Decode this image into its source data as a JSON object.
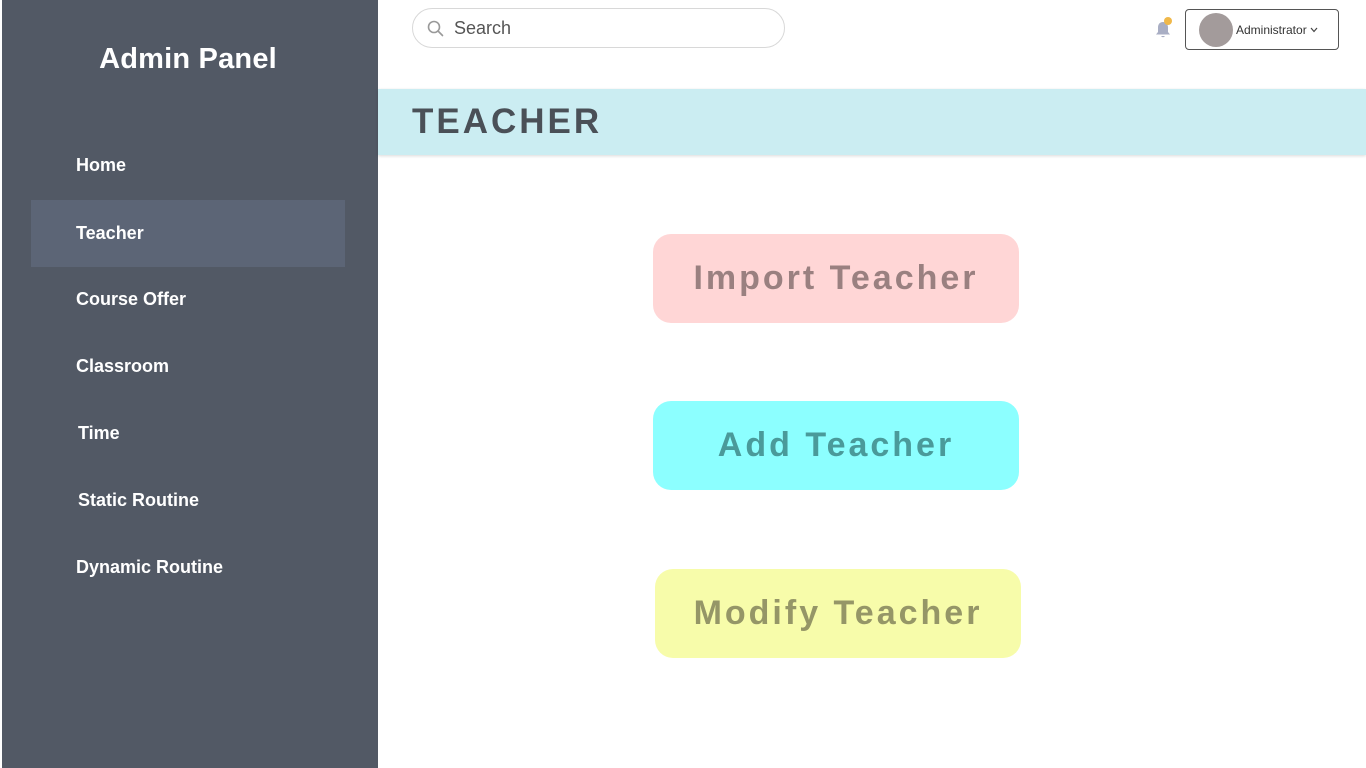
{
  "sidebar": {
    "brand": "Admin Panel",
    "items": [
      {
        "label": "Home"
      },
      {
        "label": "Teacher",
        "active": true
      },
      {
        "label": "Course Offer"
      },
      {
        "label": "Classroom"
      },
      {
        "label": "Time"
      },
      {
        "label": "Static Routine"
      },
      {
        "label": "Dynamic Routine"
      }
    ]
  },
  "header": {
    "search": {
      "placeholder": "Search",
      "value": "",
      "icon": "search-icon"
    },
    "notifications": {
      "icon": "bell-icon",
      "badge_color": "#f0b84a"
    },
    "user": {
      "name": "Administrator",
      "icon": "chevron-down-icon"
    }
  },
  "main": {
    "title": "TEACHER",
    "actions": [
      {
        "label": "Import Teacher",
        "bg": "#ffd6d6",
        "color": "#9a8080"
      },
      {
        "label": "Add Teacher",
        "bg": "#8cffff",
        "color": "#4a9a9a"
      },
      {
        "label": "Modify Teacher",
        "bg": "#f7fcaa",
        "color": "#959667"
      }
    ]
  },
  "colors": {
    "sidebar_bg": "#525965",
    "sidebar_active": "#5c6576",
    "header_bar": "#cbedf2"
  }
}
